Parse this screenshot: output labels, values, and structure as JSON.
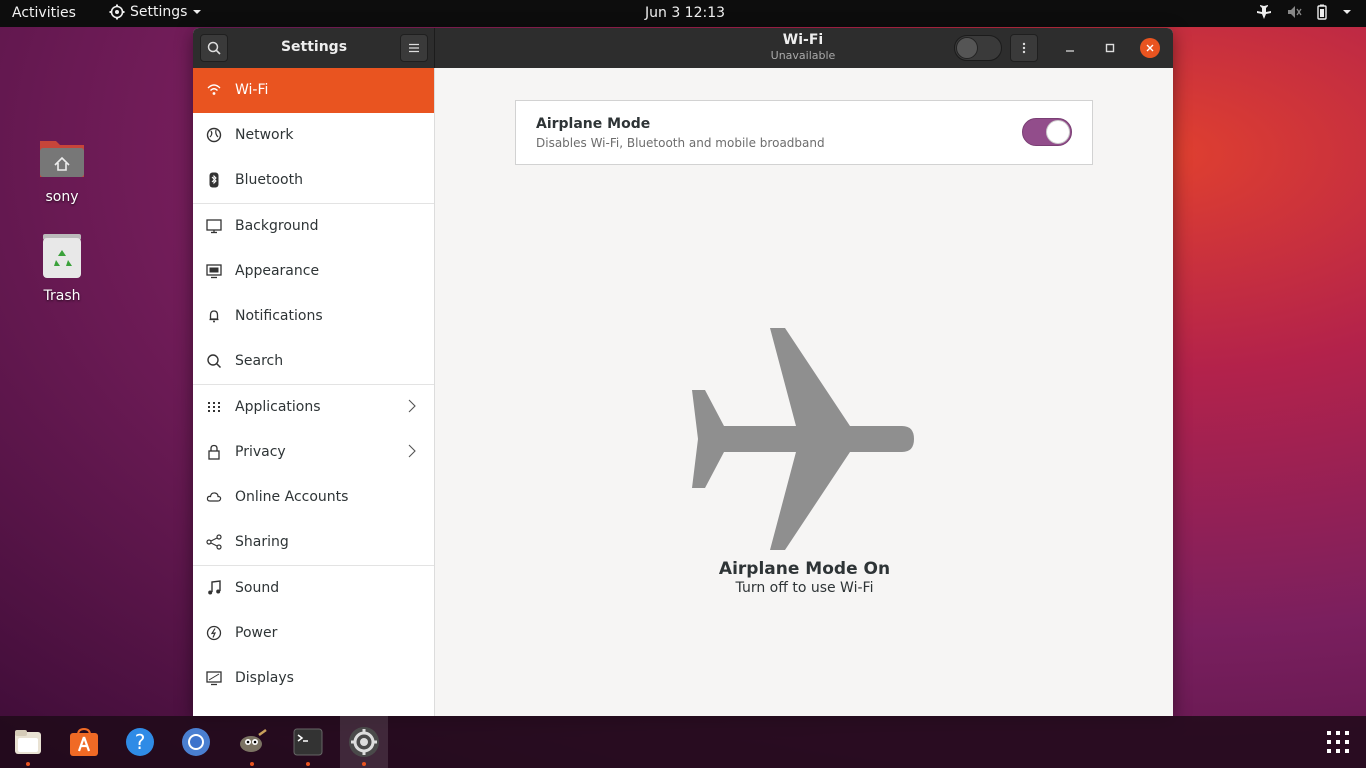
{
  "topbar": {
    "activities": "Activities",
    "app_menu": "Settings",
    "clock": "Jun 3  12:13"
  },
  "desktop": {
    "icons": [
      {
        "label": "sony"
      },
      {
        "label": "Trash"
      }
    ]
  },
  "window": {
    "sidebar_title": "Settings",
    "panel_title": "Wi-Fi",
    "panel_subtitle": "Unavailable",
    "wifi_switch_on": false
  },
  "sidebar": {
    "items": [
      {
        "label": "Wi-Fi",
        "icon": "wifi-icon",
        "active": true
      },
      {
        "label": "Network",
        "icon": "network-icon"
      },
      {
        "label": "Bluetooth",
        "icon": "bluetooth-icon"
      },
      {
        "label": "Background",
        "icon": "background-icon"
      },
      {
        "label": "Appearance",
        "icon": "appearance-icon"
      },
      {
        "label": "Notifications",
        "icon": "bell-icon"
      },
      {
        "label": "Search",
        "icon": "search-icon"
      },
      {
        "label": "Applications",
        "icon": "apps-grid-icon",
        "chevron": true
      },
      {
        "label": "Privacy",
        "icon": "lock-icon",
        "chevron": true
      },
      {
        "label": "Online Accounts",
        "icon": "cloud-icon"
      },
      {
        "label": "Sharing",
        "icon": "share-icon"
      },
      {
        "label": "Sound",
        "icon": "music-note-icon"
      },
      {
        "label": "Power",
        "icon": "power-icon"
      },
      {
        "label": "Displays",
        "icon": "display-icon"
      }
    ]
  },
  "main": {
    "airplane_card": {
      "title": "Airplane Mode",
      "subtitle": "Disables Wi-Fi, Bluetooth and mobile broadband",
      "enabled": true
    },
    "status_title": "Airplane Mode On",
    "status_subtitle": "Turn off to use Wi-Fi"
  },
  "colors": {
    "accent": "#e95420",
    "toggle_on": "#924d8b",
    "topbar": "#0d0d0d"
  },
  "dock": {
    "items": [
      "files-icon",
      "software-store-icon",
      "help-icon",
      "chromium-icon",
      "gimp-icon",
      "terminal-icon",
      "settings-icon"
    ],
    "show_apps_icon": "app-grid-icon"
  }
}
